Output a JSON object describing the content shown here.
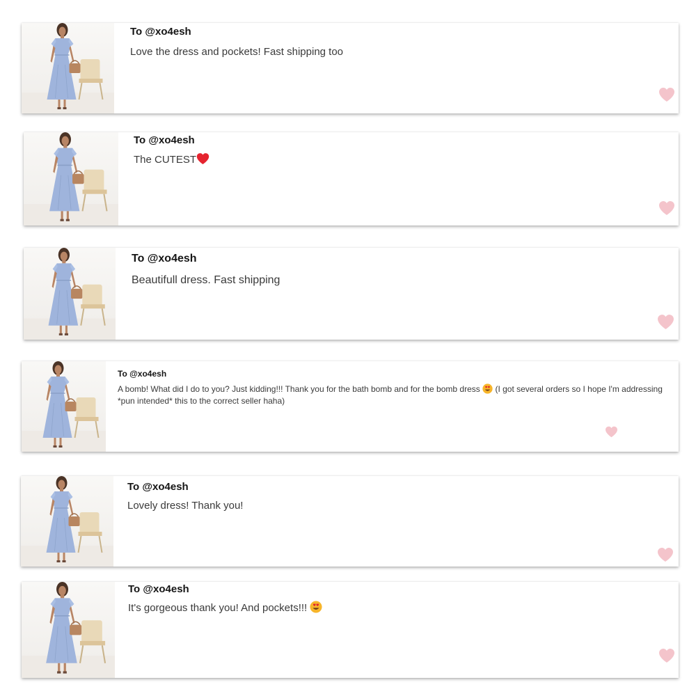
{
  "colors": {
    "heart": "#f4c4cb",
    "dress": "#9fb4dc",
    "card_background": "#ffffff"
  },
  "icons": {
    "like": "heart-icon",
    "red_heart_emoji": "red-heart-emoji-icon",
    "heart_eyes_emoji": "heart-eyes-emoji-icon"
  },
  "reviews": [
    {
      "recipient": "To @xo4esh",
      "message": "Love the dress and pockets! Fast shipping too"
    },
    {
      "recipient": "To @xo4esh",
      "message": "The CUTEST"
    },
    {
      "recipient": "To @xo4esh",
      "message": "Beautifull dress. Fast shipping"
    },
    {
      "recipient": "To @xo4esh",
      "message": "A bomb! What did I do to you? Just kidding!!! Thank you for the bath bomb and for the bomb dress",
      "message_cont": "(I got several orders so I hope I'm addressing *pun intended* this to the correct seller haha)"
    },
    {
      "recipient": "To @xo4esh",
      "message": "Lovely dress! Thank you!"
    },
    {
      "recipient": "To @xo4esh",
      "message": "It's gorgeous thank you! And pockets!!!"
    }
  ]
}
